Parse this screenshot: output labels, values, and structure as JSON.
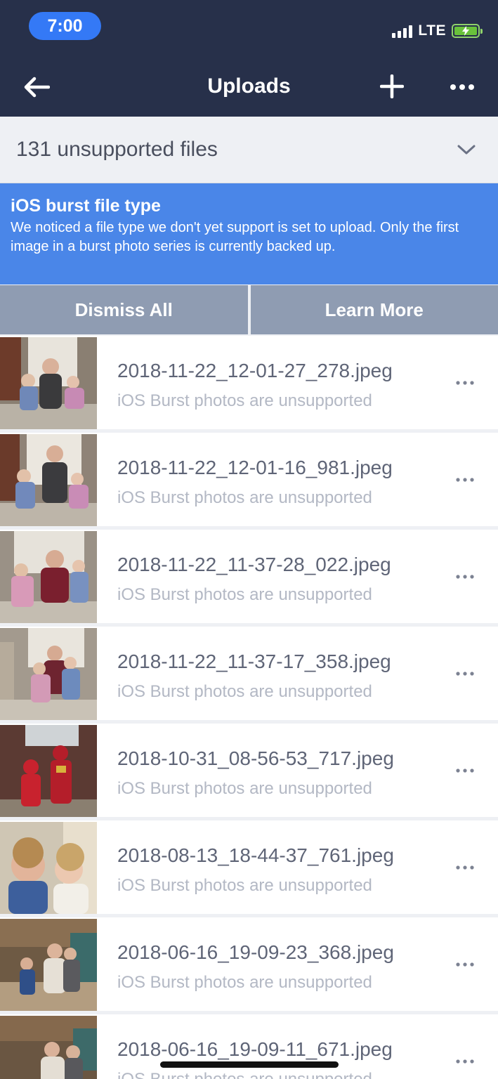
{
  "status_bar": {
    "time": "7:00",
    "network": "LTE",
    "icons": [
      "signal-icon",
      "battery-charging-icon"
    ],
    "colors": {
      "time_pill": "#3479f6",
      "battery": "#69c23b"
    }
  },
  "nav": {
    "title": "Uploads",
    "icons": [
      "back-arrow-icon",
      "plus-icon",
      "more-horizontal-icon"
    ],
    "background": "#27304a"
  },
  "section": {
    "title": "131 unsupported files",
    "expanded": true,
    "icon": "chevron-down-icon"
  },
  "banner": {
    "title": "iOS burst file type",
    "body": "We noticed a file type we don't yet support is set to upload. Only the first image in a burst photo series is currently backed up.",
    "color": "#4a86e8"
  },
  "actions": {
    "dismiss_label": "Dismiss All",
    "learn_label": "Learn More",
    "color": "#8f9cb2"
  },
  "files": [
    {
      "name": "2018-11-22_12-01-27_278.jpeg",
      "status": "iOS Burst photos are unsupported"
    },
    {
      "name": "2018-11-22_12-01-16_981.jpeg",
      "status": "iOS Burst photos are unsupported"
    },
    {
      "name": "2018-11-22_11-37-28_022.jpeg",
      "status": "iOS Burst photos are unsupported"
    },
    {
      "name": "2018-11-22_11-37-17_358.jpeg",
      "status": "iOS Burst photos are unsupported"
    },
    {
      "name": "2018-10-31_08-56-53_717.jpeg",
      "status": "iOS Burst photos are unsupported"
    },
    {
      "name": "2018-08-13_18-44-37_761.jpeg",
      "status": "iOS Burst photos are unsupported"
    },
    {
      "name": "2018-06-16_19-09-23_368.jpeg",
      "status": "iOS Burst photos are unsupported"
    },
    {
      "name": "2018-06-16_19-09-11_671.jpeg",
      "status": "iOS Burst photos are unsupported"
    }
  ]
}
